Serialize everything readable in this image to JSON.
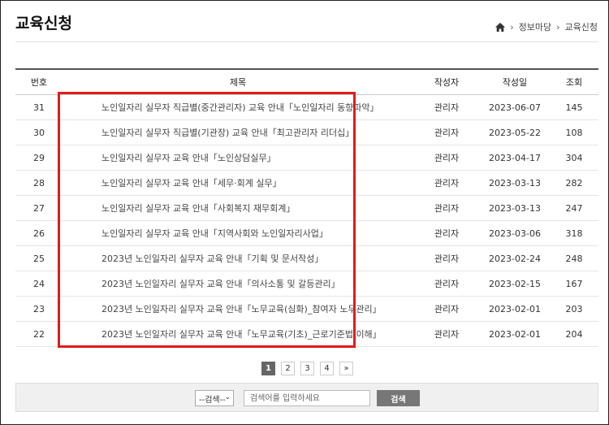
{
  "page": {
    "title": "교육신청"
  },
  "breadcrumb": {
    "items": [
      "정보마당",
      "교육신청"
    ]
  },
  "table": {
    "headers": {
      "num": "번호",
      "subject": "제목",
      "writer": "작성자",
      "date": "작성일",
      "views": "조회"
    },
    "rows": [
      {
        "num": "31",
        "subject": "노인일자리 실무자 직급별(중간관리자) 교육 안내「노인일자리 동향파악」",
        "writer": "관리자",
        "date": "2023-06-07",
        "views": "145"
      },
      {
        "num": "30",
        "subject": "노인일자리 실무자 직급별(기관장) 교육 안내「최고관리자 리더십」",
        "writer": "관리자",
        "date": "2023-05-22",
        "views": "108"
      },
      {
        "num": "29",
        "subject": "노인일자리 실무자 교육 안내「노인상담실무」",
        "writer": "관리자",
        "date": "2023-04-17",
        "views": "304"
      },
      {
        "num": "28",
        "subject": "노인일자리 실무자 교육 안내「세무·회계 실무」",
        "writer": "관리자",
        "date": "2023-03-13",
        "views": "282"
      },
      {
        "num": "27",
        "subject": "노인일자리 실무자 교육 안내「사회복지 재무회계」",
        "writer": "관리자",
        "date": "2023-03-13",
        "views": "247"
      },
      {
        "num": "26",
        "subject": "노인일자리 실무자 교육 안내「지역사회와 노인일자리사업」",
        "writer": "관리자",
        "date": "2023-03-06",
        "views": "318"
      },
      {
        "num": "25",
        "subject": "2023년 노인일자리 실무자 교육 안내「기획 및 문서작성」",
        "writer": "관리자",
        "date": "2023-02-24",
        "views": "248"
      },
      {
        "num": "24",
        "subject": "2023년 노인일자리 실무자 교육 안내「의사소통 및 갈등관리」",
        "writer": "관리자",
        "date": "2023-02-15",
        "views": "167"
      },
      {
        "num": "23",
        "subject": "2023년 노인일자리 실무자 교육 안내「노무교육(심화)_참여자 노무관리」",
        "writer": "관리자",
        "date": "2023-02-01",
        "views": "203"
      },
      {
        "num": "22",
        "subject": "2023년 노인일자리 실무자 교육 안내「노무교육(기초)_근로기준법 이해」",
        "writer": "관리자",
        "date": "2023-02-01",
        "views": "204"
      }
    ]
  },
  "highlight": {
    "color": "#e01b1b"
  },
  "pagination": {
    "pages": [
      "1",
      "2",
      "3",
      "4"
    ],
    "current": "1",
    "next_symbol": "»"
  },
  "search": {
    "select_value": "--검색--",
    "input_placeholder": "검색어를 입력하세요",
    "button_label": "검색"
  }
}
